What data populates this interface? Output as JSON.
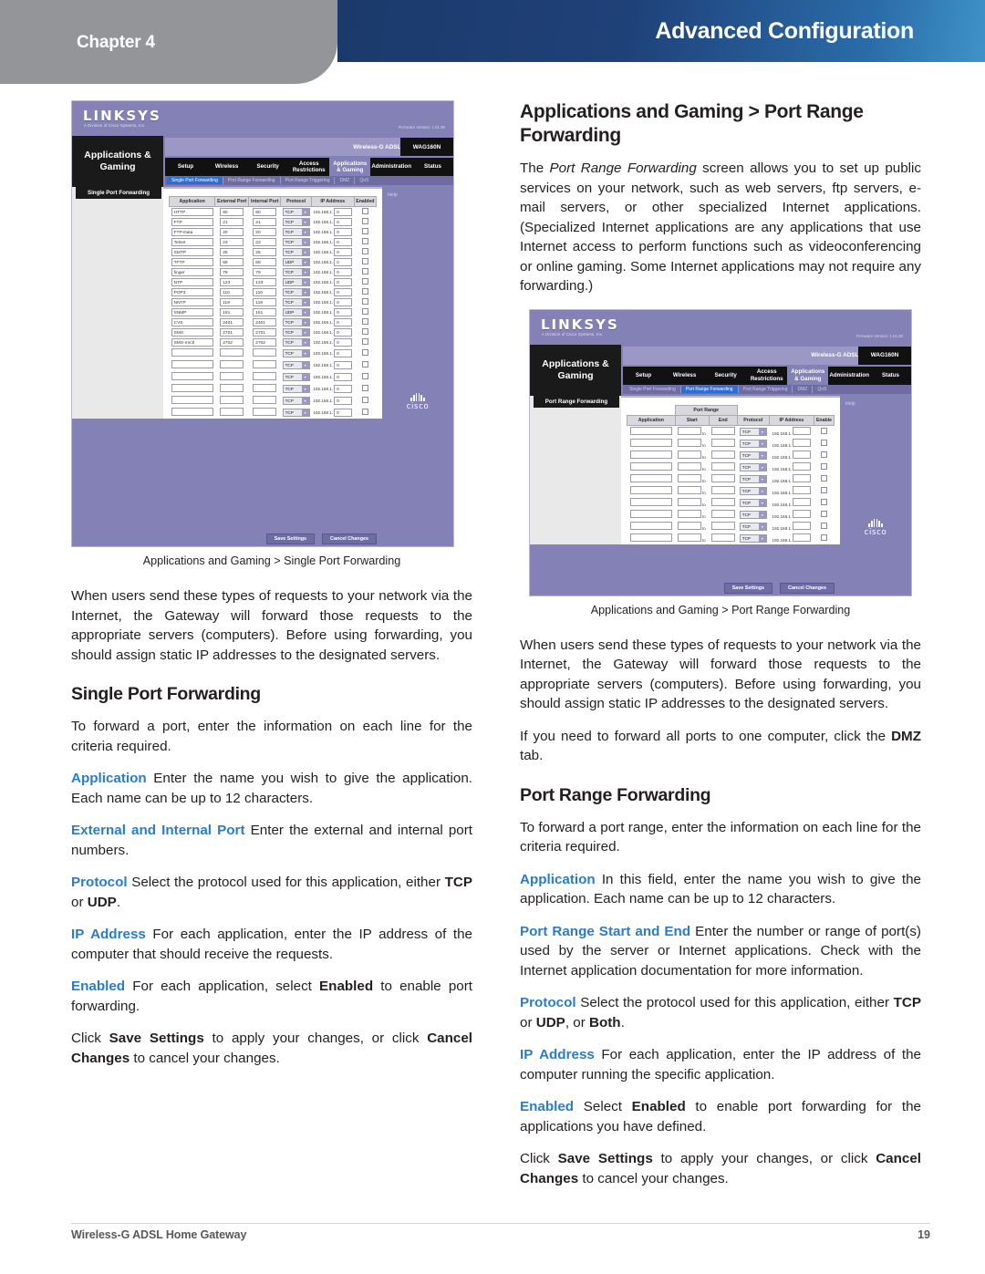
{
  "header": {
    "chapter": "Chapter 4",
    "title": "Advanced Configuration"
  },
  "footer": {
    "product": "Wireless-G ADSL Home Gateway",
    "page": "19"
  },
  "left_column": {
    "figure1_caption": "Applications and Gaming > Single Port Forwarding",
    "intro_paragraph": "When users send these types of requests to your network via the Internet, the Gateway will forward those requests to the appropriate servers (computers). Before using forwarding, you should assign static IP addresses to the designated servers.",
    "heading": "Single Port Forwarding",
    "lead": "To forward a port, enter the information on each line for the criteria required.",
    "defs": [
      {
        "term": "Application",
        "text_before": "",
        "text": " Enter the name you wish to give the application. Each name can be up to 12 characters."
      },
      {
        "term": "External and Internal Port",
        "text": " Enter the external and internal port numbers."
      },
      {
        "term": "Protocol",
        "text_a": " Select the protocol used for this application, either ",
        "bold_a": "TCP",
        "text_b": " or ",
        "bold_b": "UDP",
        "text_c": "."
      },
      {
        "term": "IP Address",
        "text": "  For each application, enter the IP address of the computer that should receive the requests."
      },
      {
        "term": "Enabled",
        "text_a": "  For each application, select ",
        "bold_a": "Enabled",
        "text_b": " to enable port forwarding."
      }
    ],
    "closing": {
      "a": "Click ",
      "b1": "Save Settings",
      "c": " to apply your changes, or click ",
      "b2": "Cancel Changes",
      "d": " to cancel your changes."
    }
  },
  "right_column": {
    "heading1": "Applications and Gaming > Port Range Forwarding",
    "intro": {
      "a": "The ",
      "italic": "Port Range Forwarding",
      "b": " screen allows you to set up public services on your network, such as web servers, ftp servers, e-mail servers, or other specialized Internet applications. (Specialized Internet applications are any applications that use Internet access to perform functions such as videoconferencing or online gaming. Some Internet applications may not require any forwarding.)"
    },
    "figure2_caption": "Applications and Gaming > Port Range Forwarding",
    "para_users": "When users send these types of requests to your network via the Internet, the Gateway will forward those requests to the appropriate servers (computers). Before using forwarding, you should assign static IP addresses to the designated servers.",
    "para_dmz": {
      "a": "If you need to forward all ports to one computer, click the ",
      "bold": "DMZ",
      "b": " tab."
    },
    "heading2": "Port Range Forwarding",
    "lead": "To forward a port range, enter the information on each line for the criteria required.",
    "defs": [
      {
        "term": "Application",
        "text": "  In this field, enter the name you wish to give the application. Each name can be up to 12 characters."
      },
      {
        "term": "Port Range Start and End",
        "text": "  Enter the number or range of port(s) used by the server or Internet applications. Check with the Internet application documentation for more information."
      },
      {
        "term": "Protocol",
        "text_a": " Select the protocol used for this application, either ",
        "bold_a": "TCP",
        "text_b": " or ",
        "bold_b": "UDP",
        "text_c": ", or ",
        "bold_c": "Both",
        "text_d": "."
      },
      {
        "term": "IP Address",
        "text": "  For each application, enter the IP address of the computer running the specific application."
      },
      {
        "term": "Enabled",
        "text_a": " Select ",
        "bold_a": "Enabled",
        "text_b": " to enable port forwarding for the applications you have defined."
      }
    ],
    "closing": {
      "a": "Click ",
      "b1": "Save Settings",
      "c": " to apply your changes, or click ",
      "b2": "Cancel Changes",
      "d": " to cancel your changes."
    }
  },
  "router_ui": {
    "brand": "LINKSYS",
    "brand_sub": "A Division of Cisco Systems, Inc.",
    "firmware": "Firmware Version: 1.01.00",
    "model_name": "Wireless-G ADSL Home Gateway",
    "model_code": "WAG160N",
    "section_title": "Applications & Gaming",
    "tabs": [
      "Setup",
      "Wireless",
      "Security",
      "Access Restrictions",
      "Applications & Gaming",
      "Administration",
      "Status"
    ],
    "active_tab": "Applications & Gaming",
    "subtabs": [
      "Single Port Forwarding",
      "Port Range Forwarding",
      "Port Range Triggering",
      "DMZ",
      "QoS"
    ],
    "help_label": "Help",
    "cisco_word": "cisco",
    "save_button": "Save Settings",
    "cancel_button": "Cancel Changes",
    "single_port": {
      "sidebar_label": "Single Port Forwarding",
      "columns": [
        "Application",
        "External Port",
        "Internal Port",
        "Protocol",
        "IP Address",
        "Enabled"
      ],
      "ip_prefix": "192.168.1.",
      "rows": [
        {
          "app": "HTTP",
          "ext": "80",
          "int": "80",
          "proto": "TCP",
          "ip": "0",
          "enabled": false
        },
        {
          "app": "FTP",
          "ext": "21",
          "int": "21",
          "proto": "TCP",
          "ip": "0",
          "enabled": false
        },
        {
          "app": "FTP-Data",
          "ext": "20",
          "int": "20",
          "proto": "TCP",
          "ip": "0",
          "enabled": false
        },
        {
          "app": "Telnet",
          "ext": "23",
          "int": "23",
          "proto": "TCP",
          "ip": "0",
          "enabled": false
        },
        {
          "app": "SMTP",
          "ext": "25",
          "int": "25",
          "proto": "TCP",
          "ip": "0",
          "enabled": false
        },
        {
          "app": "TFTP",
          "ext": "69",
          "int": "69",
          "proto": "UDP",
          "ip": "0",
          "enabled": false
        },
        {
          "app": "finger",
          "ext": "79",
          "int": "79",
          "proto": "TCP",
          "ip": "0",
          "enabled": false
        },
        {
          "app": "NTP",
          "ext": "123",
          "int": "123",
          "proto": "UDP",
          "ip": "0",
          "enabled": false
        },
        {
          "app": "POP3",
          "ext": "110",
          "int": "110",
          "proto": "TCP",
          "ip": "0",
          "enabled": false
        },
        {
          "app": "NNTP",
          "ext": "119",
          "int": "119",
          "proto": "TCP",
          "ip": "0",
          "enabled": false
        },
        {
          "app": "SNMP",
          "ext": "161",
          "int": "161",
          "proto": "UDP",
          "ip": "0",
          "enabled": false
        },
        {
          "app": "CVS",
          "ext": "2401",
          "int": "2401",
          "proto": "TCP",
          "ip": "0",
          "enabled": false
        },
        {
          "app": "SMS",
          "ext": "2701",
          "int": "2701",
          "proto": "TCP",
          "ip": "0",
          "enabled": false
        },
        {
          "app": "SMS-rmctl",
          "ext": "2702",
          "int": "2702",
          "proto": "TCP",
          "ip": "0",
          "enabled": false
        },
        {
          "app": "",
          "ext": "",
          "int": "",
          "proto": "TCP",
          "ip": "0",
          "enabled": false
        },
        {
          "app": "",
          "ext": "",
          "int": "",
          "proto": "TCP",
          "ip": "0",
          "enabled": false
        },
        {
          "app": "",
          "ext": "",
          "int": "",
          "proto": "TCP",
          "ip": "0",
          "enabled": false
        },
        {
          "app": "",
          "ext": "",
          "int": "",
          "proto": "TCP",
          "ip": "0",
          "enabled": false
        },
        {
          "app": "",
          "ext": "",
          "int": "",
          "proto": "TCP",
          "ip": "0",
          "enabled": false
        },
        {
          "app": "",
          "ext": "",
          "int": "",
          "proto": "TCP",
          "ip": "0",
          "enabled": false
        }
      ]
    },
    "port_range": {
      "sidebar_label": "Port Range Forwarding",
      "group_header": "Port Range",
      "columns": [
        "Application",
        "Start",
        "End",
        "Protocol",
        "IP Address",
        "Enable"
      ],
      "range_sep": "to",
      "ip_prefix": "192.168.1.",
      "rows": [
        {
          "app": "",
          "start": "",
          "end": "",
          "proto": "TCP",
          "ip": "",
          "enabled": false
        },
        {
          "app": "",
          "start": "",
          "end": "",
          "proto": "TCP",
          "ip": "",
          "enabled": false
        },
        {
          "app": "",
          "start": "",
          "end": "",
          "proto": "TCP",
          "ip": "",
          "enabled": false
        },
        {
          "app": "",
          "start": "",
          "end": "",
          "proto": "TCP",
          "ip": "",
          "enabled": false
        },
        {
          "app": "",
          "start": "",
          "end": "",
          "proto": "TCP",
          "ip": "",
          "enabled": false
        },
        {
          "app": "",
          "start": "",
          "end": "",
          "proto": "TCP",
          "ip": "",
          "enabled": false
        },
        {
          "app": "",
          "start": "",
          "end": "",
          "proto": "TCP",
          "ip": "",
          "enabled": false
        },
        {
          "app": "",
          "start": "",
          "end": "",
          "proto": "TCP",
          "ip": "",
          "enabled": false
        },
        {
          "app": "",
          "start": "",
          "end": "",
          "proto": "TCP",
          "ip": "",
          "enabled": false
        },
        {
          "app": "",
          "start": "",
          "end": "",
          "proto": "TCP",
          "ip": "",
          "enabled": false
        }
      ]
    }
  },
  "colors": {
    "banner_grey": "#939598",
    "banner_blue_dark": "#1b3a6b",
    "banner_blue_light": "#3f93c9",
    "term_blue": "#2b7cc4",
    "router_purple": "#8481b6",
    "footer_grey": "#58595b"
  }
}
